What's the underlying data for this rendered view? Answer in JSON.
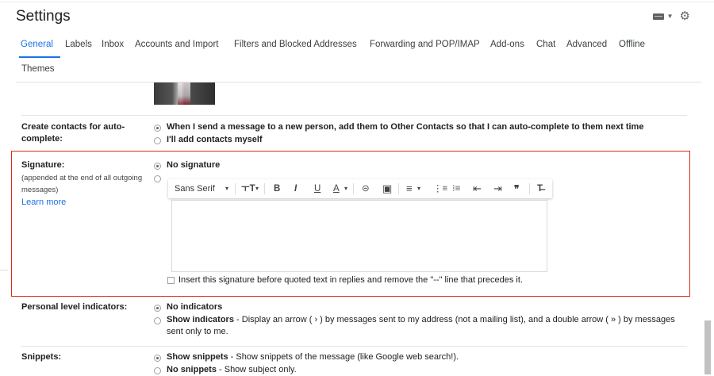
{
  "header": {
    "title": "Settings",
    "icons": [
      "keyboard-icon",
      "dropdown-caret-icon",
      "gear-icon"
    ]
  },
  "tabs": [
    {
      "label": "General",
      "active": true
    },
    {
      "label": "Labels"
    },
    {
      "label": "Inbox"
    },
    {
      "label": "Accounts and Import"
    },
    {
      "label": "Filters and Blocked Addresses"
    },
    {
      "label": "Forwarding and POP/IMAP"
    },
    {
      "label": "Add-ons"
    },
    {
      "label": "Chat"
    },
    {
      "label": "Advanced"
    },
    {
      "label": "Offline"
    },
    {
      "label": "Themes"
    }
  ],
  "contacts": {
    "label": "Create contacts for auto-",
    "label_line2": "complete:",
    "opt1": "When I send a message to a new person, add them to Other Contacts so that I can auto-complete to them next time",
    "opt2": "I'll add contacts myself",
    "selected": 1
  },
  "signature": {
    "label": "Signature:",
    "sublabel1": "(appended at the end of all outgoing",
    "sublabel2": "messages)",
    "learn_more": "Learn more",
    "opt_none": "No signature",
    "toolbar": {
      "font": "Sans Serif",
      "font_caret": "▾",
      "size": "ㅜT",
      "size_caret": "▾",
      "bold": "B",
      "italic": "I",
      "underline": "U",
      "textcolor": "A",
      "textcolor_caret": "▾",
      "link": "⊝",
      "image": "▣",
      "align": "≡",
      "align_caret": "▾",
      "numbered": "⋮≡",
      "bulleted": "⁝≡",
      "indent_less": "⇤",
      "indent_more": "⇥",
      "quote": "❞",
      "clear": "T̶"
    },
    "checkbox_label": "Insert this signature before quoted text in replies and remove the \"--\" line that precedes it."
  },
  "indicators": {
    "label": "Personal level indicators:",
    "opt1": "No indicators",
    "opt2_bold": "Show indicators",
    "opt2_rest": " - Display an arrow ( › ) by messages sent to my address (not a mailing list), and a double arrow ( » ) by messages",
    "opt2_cont": "sent only to me.",
    "selected": 1
  },
  "snippets": {
    "label": "Snippets:",
    "opt1_bold": "Show snippets",
    "opt1_rest": " - Show snippets of the message (like Google web search!).",
    "opt2_bold": "No snippets",
    "opt2_rest": " - Show subject only.",
    "selected": 1
  }
}
